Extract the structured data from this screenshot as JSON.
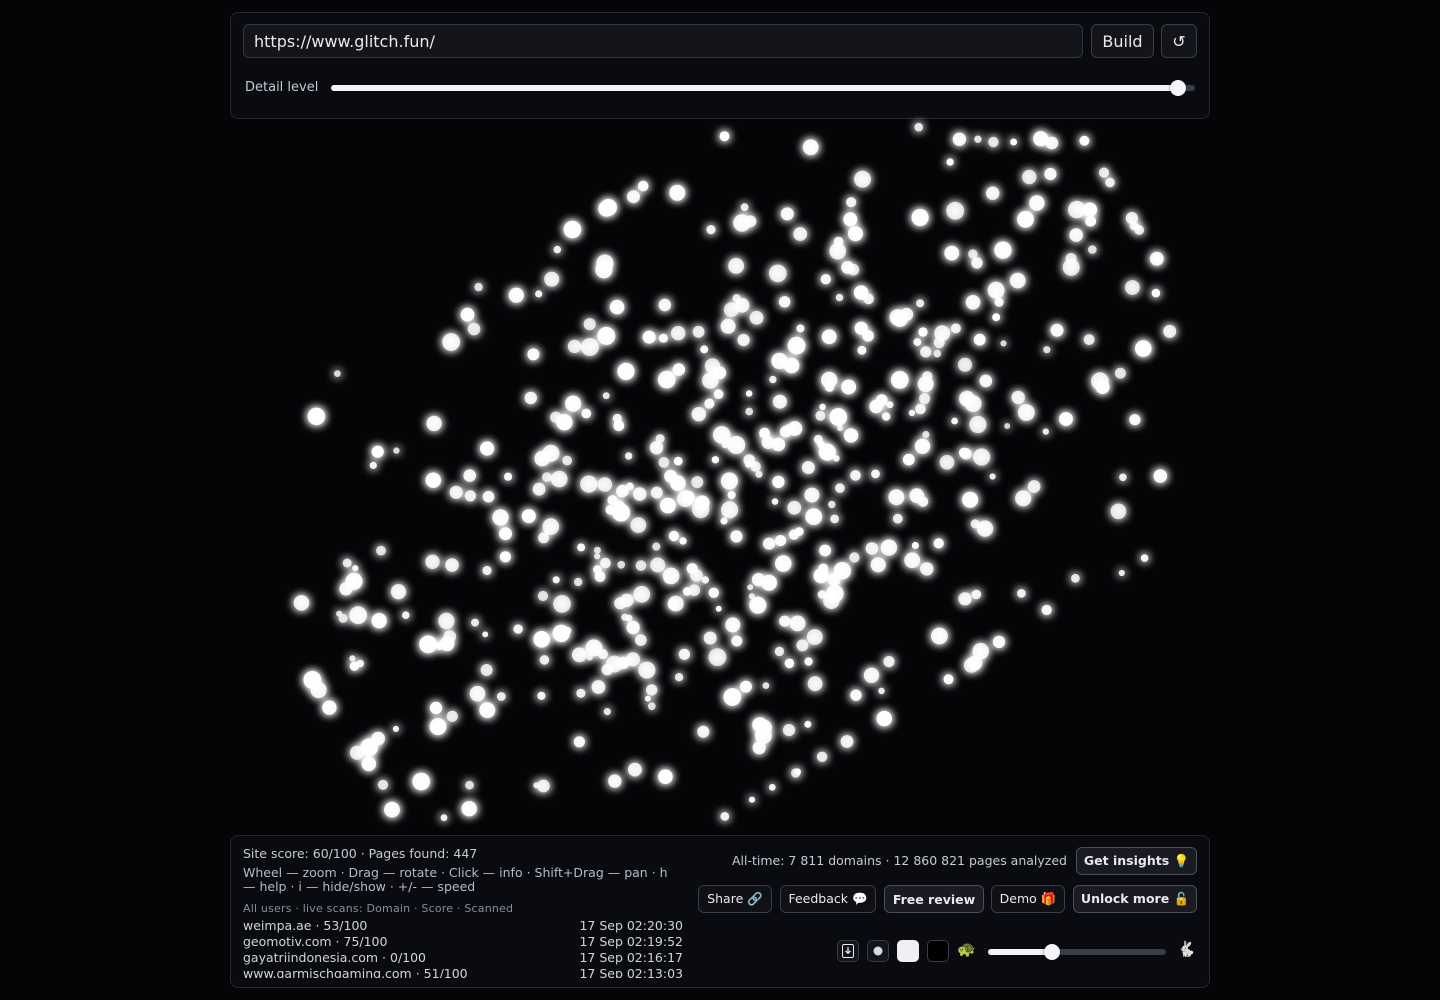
{
  "top": {
    "url_value": "https://www.glitch.fun/",
    "build_label": "Build",
    "reset_glyph": "↺",
    "detail_label": "Detail level",
    "detail_level_fraction": 0.98
  },
  "stats": {
    "site_score_line": "Site score: 60/100 · Pages found: 447",
    "help_text": "Wheel — zoom · Drag — rotate · Click — info · Shift+Drag — pan · h — help · i — hide/show · +/- — speed",
    "live_header": "All users · live scans: Domain · Score · Scanned",
    "scans": [
      {
        "domain": "weimpa.ae · 53/100",
        "time": "17 Sep 02:20:30"
      },
      {
        "domain": "geomotiv.com · 75/100",
        "time": "17 Sep 02:19:52"
      },
      {
        "domain": "gayatriindonesia.com · 0/100",
        "time": "17 Sep 02:16:17"
      },
      {
        "domain": "www.garmischgaming.com · 51/100",
        "time": "17 Sep 02:13:03"
      }
    ],
    "alltime_line": "All-time: 7 811 domains · 12 860 821 pages analyzed"
  },
  "actions": {
    "insights_label": "Get insights 💡",
    "share_label": "Share 🔗",
    "feedback_label": "Feedback 💬",
    "review_label": "Free review",
    "demo_label": "Demo 🎁",
    "unlock_label": "Unlock more 🔓"
  },
  "controls": {
    "turtle_glyph": "🐢",
    "rabbit_glyph": "🐇",
    "speed_fraction": 0.36
  },
  "icons": {
    "reset": "refresh-icon",
    "download": "download-icon",
    "dot": "dot-icon",
    "light_theme": "light-swatch-icon",
    "dark_theme": "dark-swatch-icon",
    "slow": "turtle-icon",
    "fast": "rabbit-icon"
  },
  "colors": {
    "background": "#050508",
    "node": "#ffffff",
    "glow": "#b8c4ff"
  }
}
